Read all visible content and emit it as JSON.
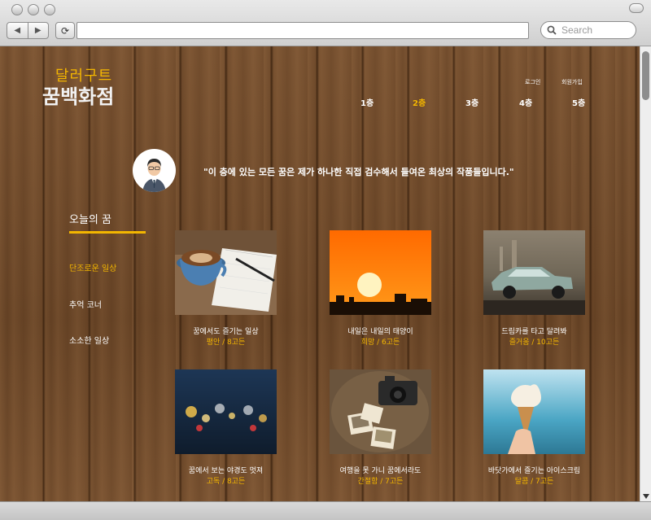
{
  "browser": {
    "search_placeholder": "Search",
    "back_glyph": "◀",
    "forward_glyph": "▶",
    "reload_glyph": "⟳"
  },
  "site": {
    "logo_top": "달러구트",
    "logo_bottom": "꿈백화점",
    "util": {
      "login": "로그인",
      "signup": "회원가입"
    },
    "floors": [
      "1층",
      "2층",
      "3층",
      "4층",
      "5층"
    ],
    "active_floor": "2층",
    "quote": "\"이 층에 있는 모든 꿈은 제가 하나한 직접 검수해서 들여온 최상의 작품들입니다.\"",
    "sidebar": {
      "title": "오늘의 꿈",
      "items": [
        "단조로운 일상",
        "추억 코너",
        "소소한 일상"
      ]
    },
    "cards": [
      {
        "title": "꿈에서도 즐기는 일상",
        "meta": "평안 / 8고든"
      },
      {
        "title": "내일은 내일의 태양이",
        "meta": "희망 / 6고든"
      },
      {
        "title": "드림카를 타고 달려봐",
        "meta": "즐거움 / 10고든"
      },
      {
        "title": "꿈에서 보는 야경도 멋져",
        "meta": "고독 / 8고든"
      },
      {
        "title": "여행을 못 가니 꿈에서라도",
        "meta": "간절함 / 7고든"
      },
      {
        "title": "바닷가에서 즐기는 아이스크림",
        "meta": "달콤 / 7고든"
      }
    ]
  },
  "colors": {
    "accent": "#f3b600",
    "text": "#ffffff"
  }
}
